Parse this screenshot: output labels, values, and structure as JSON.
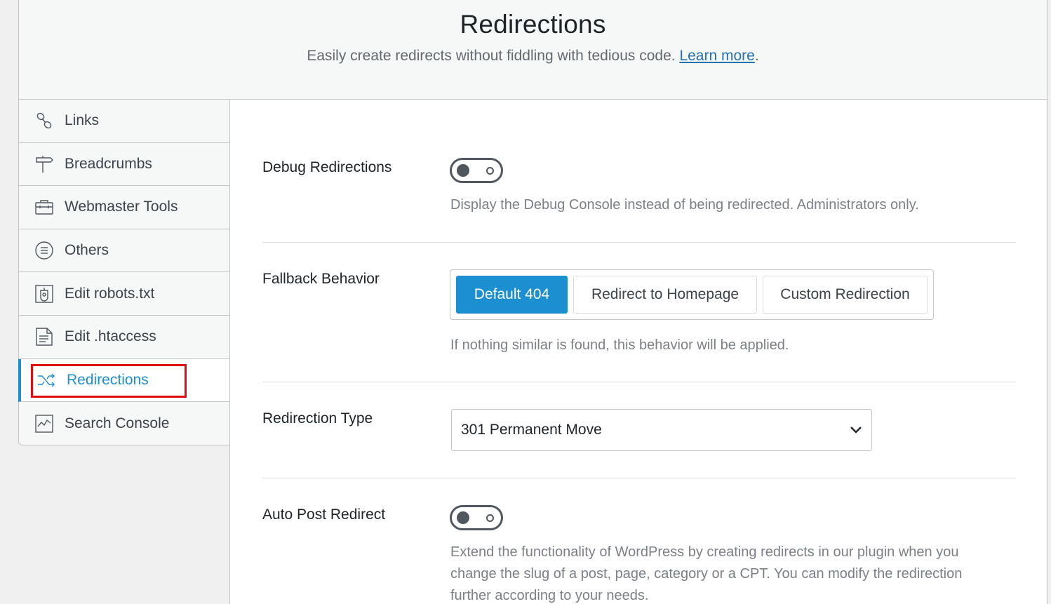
{
  "header": {
    "title": "Redirections",
    "subtitle": "Easily create redirects without fiddling with tedious code.",
    "learn_more": "Learn more",
    "period": "."
  },
  "sidebar": {
    "items": [
      {
        "label": "Links",
        "icon": "link-icon"
      },
      {
        "label": "Breadcrumbs",
        "icon": "signpost-icon"
      },
      {
        "label": "Webmaster Tools",
        "icon": "toolbox-icon"
      },
      {
        "label": "Others",
        "icon": "list-circle-icon"
      },
      {
        "label": "Edit robots.txt",
        "icon": "robot-file-icon"
      },
      {
        "label": "Edit .htaccess",
        "icon": "file-text-icon"
      },
      {
        "label": "Redirections",
        "icon": "shuffle-icon",
        "active": true
      },
      {
        "label": "Search Console",
        "icon": "chart-line-icon"
      }
    ]
  },
  "settings": {
    "debug": {
      "label": "Debug Redirections",
      "enabled": false,
      "description": "Display the Debug Console instead of being redirected. Administrators only."
    },
    "fallback": {
      "label": "Fallback Behavior",
      "options": [
        "Default 404",
        "Redirect to Homepage",
        "Custom Redirection"
      ],
      "selected": "Default 404",
      "description": "If nothing similar is found, this behavior will be applied."
    },
    "redirection_type": {
      "label": "Redirection Type",
      "value": "301 Permanent Move"
    },
    "auto_post": {
      "label": "Auto Post Redirect",
      "enabled": false,
      "description_lines": [
        "Extend the functionality of WordPress by creating redirects in our plugin when you",
        "change the slug of a post, page, category or a CPT. You can modify the redirection",
        "further according to your needs."
      ]
    }
  },
  "colors": {
    "accent": "#1c8fd1",
    "highlight": "#e20c0c",
    "link": "#2271b1"
  }
}
